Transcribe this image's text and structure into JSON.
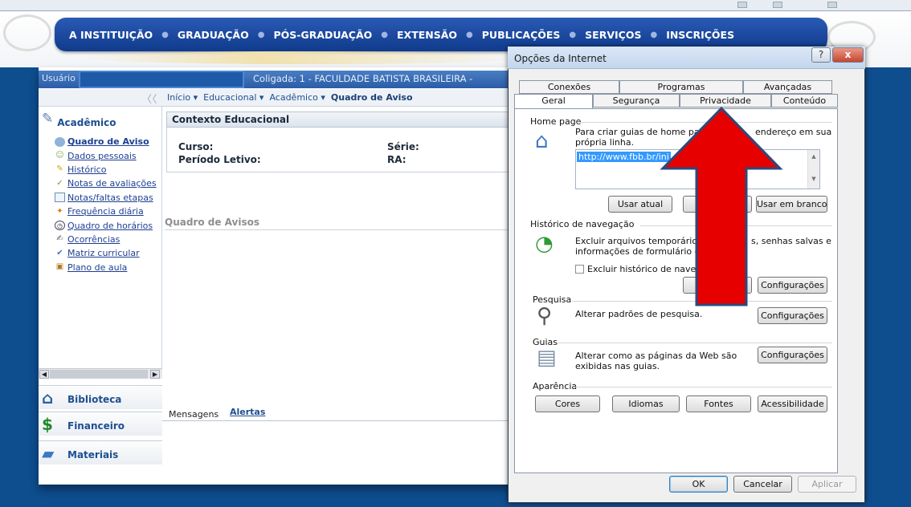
{
  "nav": {
    "items": [
      "A INSTITUIÇÃO",
      "GRADUAÇÃO",
      "PÓS-GRADUAÇÃO",
      "EXTENSÃO",
      "PUBLICAÇÕES",
      "SERVIÇOS",
      "INSCRIÇÕES"
    ],
    "separator": "●"
  },
  "portal": {
    "user_label": "Usuário",
    "coligada": "Coligada: 1 - FACULDADE BATISTA BRASILEIRA -",
    "collapse": "〈〈",
    "breadcrumb": {
      "inicio": "Início ▾",
      "educacional": "Educacional ▾",
      "academico": "Acadêmico ▾",
      "current": "Quadro de Aviso"
    },
    "section_title": "Acadêmico",
    "tree": [
      {
        "label": "Quadro de Aviso",
        "icon": "bulletin-icon",
        "bold": true
      },
      {
        "label": "Dados pessoais",
        "icon": "person-icon",
        "bold": false
      },
      {
        "label": "Histórico",
        "icon": "pencil-icon",
        "bold": false
      },
      {
        "label": "Notas de avaliações",
        "icon": "grades-icon",
        "bold": false
      },
      {
        "label": "Notas/faltas etapas",
        "icon": "table-icon",
        "bold": false
      },
      {
        "label": "Frequência diária",
        "icon": "attendance-icon",
        "bold": false
      },
      {
        "label": "Quadro de horários",
        "icon": "clock-icon",
        "bold": false
      },
      {
        "label": "Ocorrências",
        "icon": "alert-icon",
        "bold": false
      },
      {
        "label": "Matriz curricular",
        "icon": "check-icon",
        "bold": false
      },
      {
        "label": "Plano de aula",
        "icon": "book-icon",
        "bold": false
      }
    ],
    "accordion": [
      "Biblioteca",
      "Financeiro",
      "Materiais"
    ],
    "contexto_title": "Contexto Educacional",
    "curso_label": "Curso:",
    "periodo_label": "Período Letivo:",
    "serie_label": "Série:",
    "ra_label": "RA:",
    "quadro_title": "Quadro de Avisos",
    "msg_tabs": [
      "Mensagens",
      "Alertas"
    ]
  },
  "dialog": {
    "title": "Opções da Internet",
    "help_btn": "?",
    "close_btn": "x",
    "tabs_back": [
      "Conexões",
      "Programas",
      "Avançadas"
    ],
    "tabs_front": [
      "Geral",
      "Segurança",
      "Privacidade",
      "Conteúdo"
    ],
    "active_tab": "Geral",
    "home_page": {
      "group": "Home page",
      "text_a": "Para criar guias de home page,",
      "text_b": "endereço em sua",
      "text_c": "própria linha.",
      "url": "http://www.fbb.br/ini",
      "btn_current": "Usar atual",
      "btn_blank": "Usar em branco"
    },
    "history": {
      "group": "Histórico de navegação",
      "text_a": "Excluir arquivos temporários, h",
      "text_b": "s, senhas salvas e",
      "text_c": "informações de formulário da W",
      "checkbox_label": "Excluir histórico de navega",
      "btn_config": "Configurações"
    },
    "search": {
      "group": "Pesquisa",
      "text": "Alterar padrões de pesquisa.",
      "btn_config": "Configurações"
    },
    "tabs_group": {
      "group": "Guias",
      "text_a": "Alterar como as páginas da Web são",
      "text_b": "exibidas nas guias.",
      "btn_config": "Configurações"
    },
    "appearance": {
      "group": "Aparência",
      "buttons": [
        "Cores",
        "Idiomas",
        "Fontes",
        "Acessibilidade"
      ]
    },
    "footer": {
      "ok": "OK",
      "cancel": "Cancelar",
      "apply": "Aplicar"
    }
  },
  "annotation": {
    "arrow_color": "#e60000",
    "arrow_border": "#2b4a7d"
  }
}
